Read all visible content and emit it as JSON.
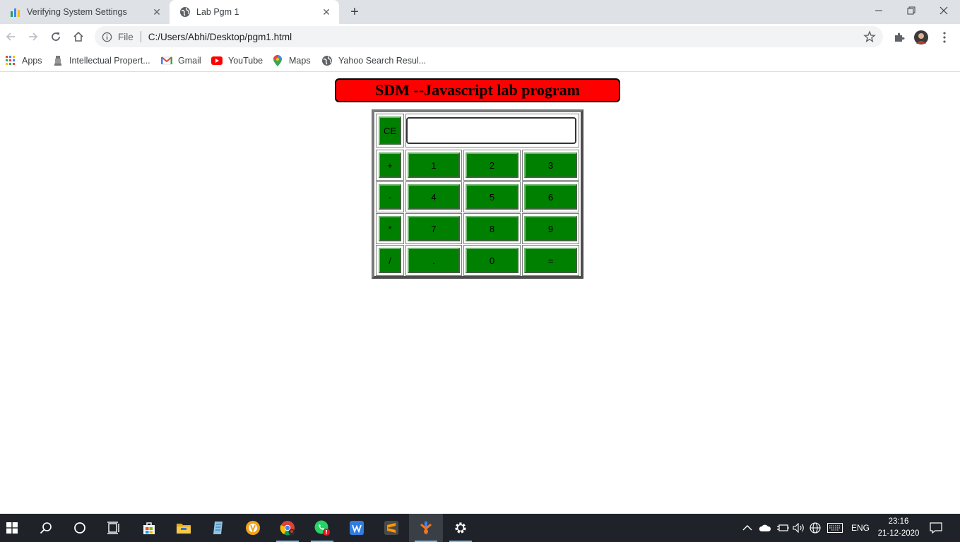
{
  "browser": {
    "tabs": [
      {
        "title": "Verifying System Settings",
        "icon": "bar-chart-icon",
        "active": false
      },
      {
        "title": "Lab Pgm 1",
        "icon": "globe-icon",
        "active": true
      }
    ],
    "address": {
      "scheme_label": "File",
      "url": "C:/Users/Abhi/Desktop/pgm1.html"
    },
    "bookmarks": [
      {
        "label": "Apps",
        "icon": "apps-grid-icon"
      },
      {
        "label": "Intellectual Propert...",
        "icon": "emblem-icon"
      },
      {
        "label": "Gmail",
        "icon": "gmail-icon"
      },
      {
        "label": "YouTube",
        "icon": "youtube-icon"
      },
      {
        "label": "Maps",
        "icon": "maps-pin-icon"
      },
      {
        "label": "Yahoo Search Resul...",
        "icon": "globe-icon"
      }
    ]
  },
  "page": {
    "heading": "SDM --Javascript lab program",
    "colors": {
      "heading_bg": "#ff0000",
      "key_bg": "#008000"
    },
    "display_value": "",
    "keys": {
      "clear": "CE",
      "rows": [
        [
          "+",
          "1",
          "2",
          "3"
        ],
        [
          "-",
          "4",
          "5",
          "6"
        ],
        [
          "*",
          "7",
          "8",
          "9"
        ],
        [
          "/",
          ".",
          "0",
          "="
        ]
      ]
    }
  },
  "taskbar": {
    "apps": [
      "start-icon",
      "search-icon",
      "cortana-icon",
      "task-view-icon",
      "store-icon",
      "file-explorer-icon",
      "notepad-icon",
      "browser-icon",
      "chrome-icon",
      "whatsapp-icon",
      "wps-writer-icon",
      "sublime-text-icon",
      "app-icon",
      "settings-icon"
    ],
    "language": "ENG",
    "time": "23:16",
    "date": "21-12-2020"
  }
}
